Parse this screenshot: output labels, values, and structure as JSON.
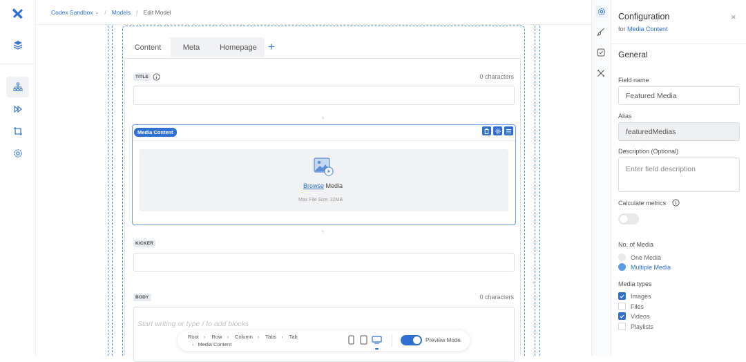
{
  "breadcrumb": {
    "workspace": "Codex Sandbox",
    "models": "Models",
    "current": "Edit Model"
  },
  "tabs": [
    {
      "label": "Content"
    },
    {
      "label": "Meta"
    },
    {
      "label": "Homepage"
    }
  ],
  "fields": {
    "title": {
      "label": "TITLE",
      "counter": "0 characters"
    },
    "media": {
      "label": "Media Content",
      "browse": "Browse",
      "browse_rest": " Media",
      "max_size": "Max File Size: 32MB"
    },
    "kicker": {
      "label": "KICKER"
    },
    "body": {
      "label": "BODY",
      "counter": "0 characters",
      "placeholder": "Start writing or type / to add blocks"
    }
  },
  "bottom_bar": {
    "crumbs": [
      "Root",
      "Row",
      "Column",
      "Tabs",
      "Tab"
    ],
    "crumb_last": "Media Content",
    "preview_label": "Preview Mode",
    "preview_on": true
  },
  "panel": {
    "title": "Configuration",
    "subtitle_prefix": "for ",
    "subtitle_link": "Media Content",
    "section": "General",
    "field_name_label": "Field name",
    "field_name_value": "Featured Media",
    "alias_label": "Alias",
    "alias_value": "featuredMedias",
    "description_label": "Description (Optional)",
    "description_placeholder": "Enter field description",
    "calc_metrics_label": "Calculate metrics",
    "calc_metrics_on": false,
    "num_media_label": "No. of Media",
    "num_media_options": [
      {
        "label": "One Media",
        "selected": false
      },
      {
        "label": "Multiple Media",
        "selected": true
      }
    ],
    "media_types_label": "Media types",
    "media_types": [
      {
        "label": "Images",
        "checked": true
      },
      {
        "label": "Files",
        "checked": false
      },
      {
        "label": "Videos",
        "checked": true
      },
      {
        "label": "Playlists",
        "checked": false
      }
    ]
  },
  "colors": {
    "accent": "#2b6fce",
    "accent_light": "#5b9be6",
    "selection_border": "#6a9be0"
  }
}
